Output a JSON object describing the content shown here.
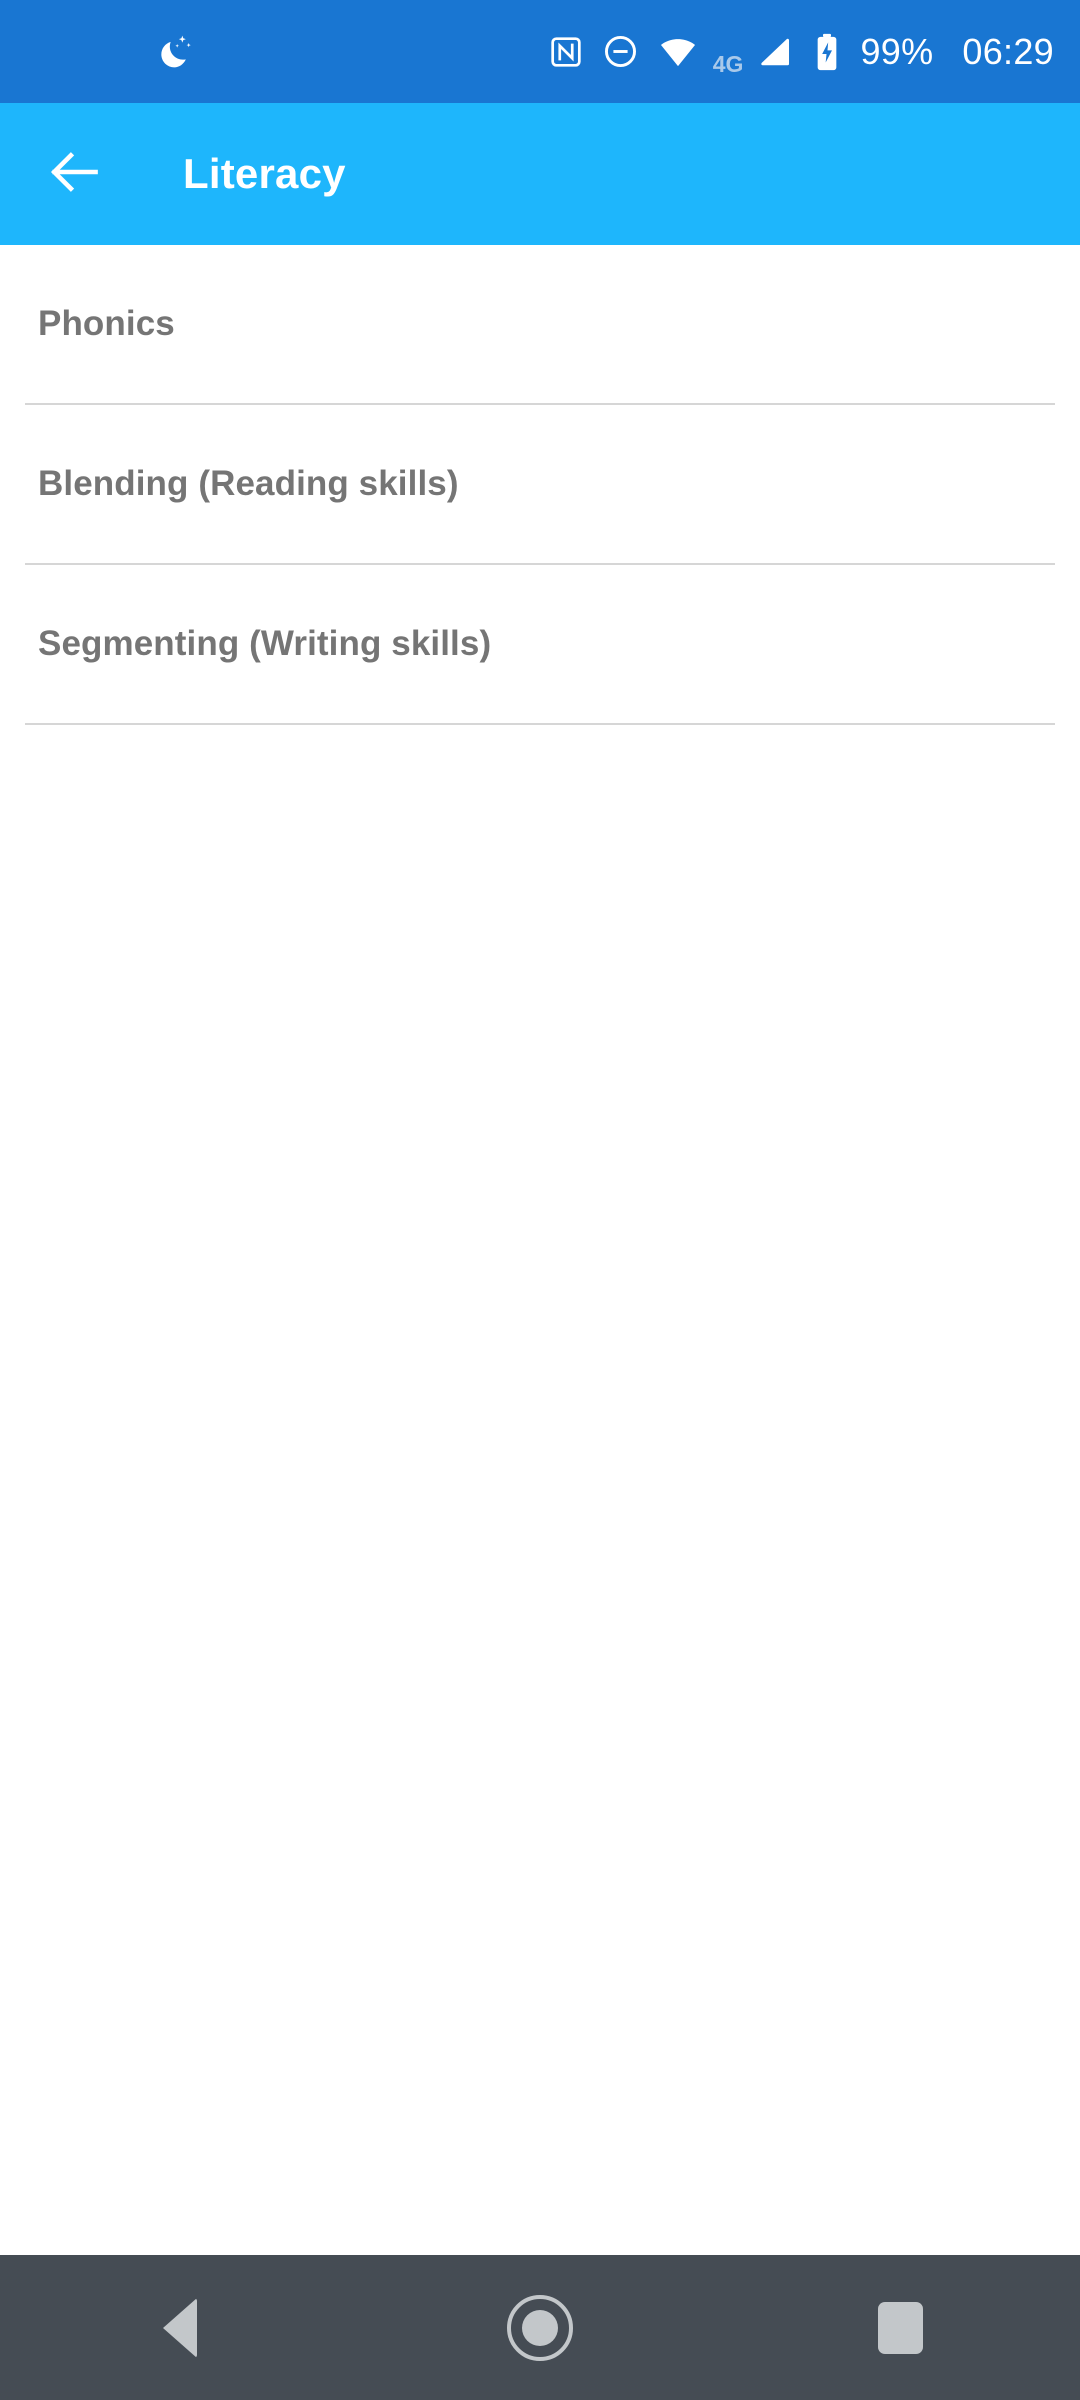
{
  "status_bar": {
    "background_color": "#1976D2",
    "foreground_color": "#FFFFFF",
    "left_icons": [
      {
        "name": "bedtime-mode-icon",
        "label": "Bedtime mode"
      }
    ],
    "right_icons": [
      {
        "name": "nfc-icon",
        "label": "NFC"
      },
      {
        "name": "do-not-disturb-icon",
        "label": "Do not disturb"
      },
      {
        "name": "wifi-icon",
        "label": "Wi-Fi"
      }
    ],
    "network_label": "4G",
    "signal_icon": "cellular-signal-icon",
    "battery_icon": "battery-charging-icon",
    "battery_percent": "99%",
    "clock": "06:29"
  },
  "app_bar": {
    "background_color": "#1EB6FC",
    "back_icon": "arrow-back-icon",
    "title": "Literacy"
  },
  "content": {
    "background_color": "#FFFFFF",
    "text_color": "#757575",
    "divider_color": "#D6D6D6",
    "items": [
      {
        "label": "Phonics"
      },
      {
        "label": "Blending (Reading skills)"
      },
      {
        "label": "Segmenting (Writing skills)"
      }
    ]
  },
  "nav_bar": {
    "background_color": "#454C54",
    "icon_color": "#C3C7CA",
    "buttons": [
      {
        "name": "nav-back",
        "label": "Back"
      },
      {
        "name": "nav-home",
        "label": "Home"
      },
      {
        "name": "nav-recents",
        "label": "Recents"
      }
    ]
  }
}
